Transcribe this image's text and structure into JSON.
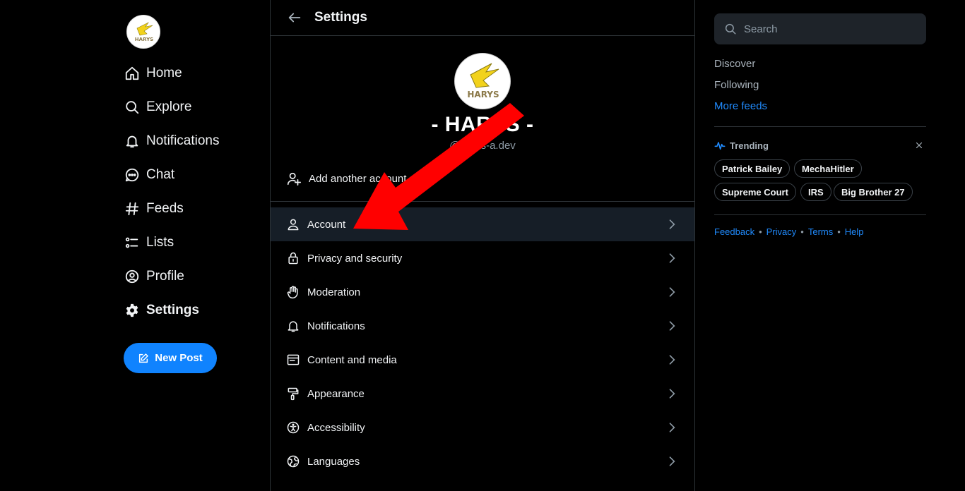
{
  "nav": {
    "items": [
      {
        "label": "Home",
        "icon": "home-icon"
      },
      {
        "label": "Explore",
        "icon": "search-icon"
      },
      {
        "label": "Notifications",
        "icon": "bell-icon"
      },
      {
        "label": "Chat",
        "icon": "chat-icon"
      },
      {
        "label": "Feeds",
        "icon": "hash-icon"
      },
      {
        "label": "Lists",
        "icon": "list-icon"
      },
      {
        "label": "Profile",
        "icon": "user-circle-icon"
      },
      {
        "label": "Settings",
        "icon": "gear-icon"
      }
    ],
    "active": "Settings",
    "new_post_label": "New Post",
    "logo_text": "HARYS"
  },
  "header": {
    "title": "Settings"
  },
  "profile": {
    "display_name": "- HARYS -",
    "handle": "@harys-a.dev",
    "avatar_text": "HARYS"
  },
  "add_account_label": "Add another account",
  "settings_items": [
    {
      "label": "Account",
      "icon": "user-icon"
    },
    {
      "label": "Privacy and security",
      "icon": "lock-icon"
    },
    {
      "label": "Moderation",
      "icon": "hand-icon"
    },
    {
      "label": "Notifications",
      "icon": "bell-icon"
    },
    {
      "label": "Content and media",
      "icon": "window-icon"
    },
    {
      "label": "Appearance",
      "icon": "paint-roller-icon"
    },
    {
      "label": "Accessibility",
      "icon": "accessibility-icon"
    },
    {
      "label": "Languages",
      "icon": "globe-icon"
    }
  ],
  "right": {
    "search_placeholder": "Search",
    "feeds": [
      "Discover",
      "Following",
      "More feeds"
    ],
    "trending_title": "Trending",
    "trending": [
      "Patrick Bailey",
      "MechaHitler",
      "Supreme Court",
      "IRS",
      "Big Brother 27"
    ],
    "footer": [
      "Feedback",
      "Privacy",
      "Terms",
      "Help"
    ]
  },
  "colors": {
    "accent": "#1083fe",
    "link": "#208bfe",
    "highlight_row": "#161e27",
    "annotation_arrow": "#ff0000",
    "logo_yellow": "#f2d21b"
  }
}
